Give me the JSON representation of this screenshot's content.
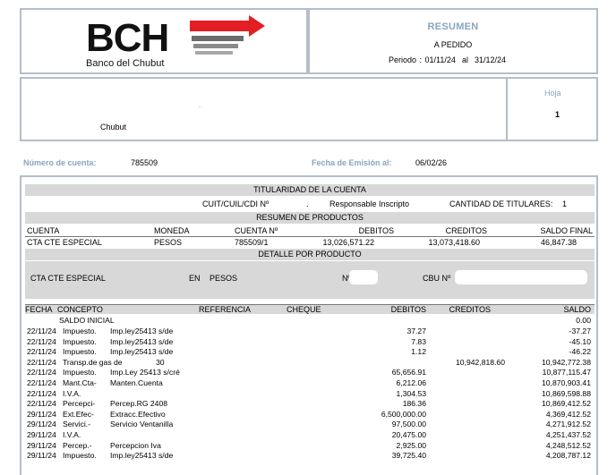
{
  "bank": {
    "logo_text": "BCH",
    "name": "Banco del Chubut",
    "brand_colors": {
      "red": "#e31e24",
      "gray": "#6b6b6b"
    }
  },
  "summary": {
    "title": "RESUMEN",
    "subtitle": "A PEDIDO",
    "period_label": "Periodo :",
    "period_from": "01/11/24",
    "period_sep": "al",
    "period_to": "31/12/24"
  },
  "client": {
    "dot": ".",
    "city": "Chubut",
    "hoja_label": "Hoja",
    "hoja_value": "1"
  },
  "account_meta": {
    "number_label": "Número de cuenta:",
    "number_value": "785509",
    "issue_label": "Fecha de Emisión al:",
    "issue_value": "06/02/26"
  },
  "titularidad": {
    "title": "TITULARIDAD DE LA CUENTA",
    "cuit_label": "CUIT/CUIL/CDI Nº",
    "dot": ".",
    "condition": "Responsable Inscripto",
    "titulares_label": "CANTIDAD DE TITULARES:",
    "titulares_value": "1"
  },
  "products": {
    "title": "RESUMEN DE PRODUCTOS",
    "headers": [
      "CUENTA",
      "MONEDA",
      "CUENTA Nº",
      "DEBITOS",
      "CREDITOS",
      "SALDO FINAL"
    ],
    "row": [
      "CTA CTE ESPECIAL",
      "PESOS",
      "785509/1",
      "13,026,571.22",
      "13,073,418.60",
      "46,847.38"
    ]
  },
  "detail": {
    "title": "DETALLE POR PRODUCTO",
    "account_type": "CTA CTE ESPECIAL",
    "currency_prefix": "EN",
    "currency": "PESOS",
    "number_label": "Nº",
    "cbu_label": "CBU Nº"
  },
  "movements": {
    "headers": [
      "FECHA",
      "CONCEPTO",
      "REFERENCIA",
      "CHEQUE",
      "DEBITOS",
      "CREDITOS",
      "SALDO"
    ],
    "opening_label": "SALDO INICIAL",
    "opening_balance": "0.00",
    "rows": [
      {
        "fecha": "22/11/24",
        "concepto": "Impuesto.",
        "detalle": "Imp.ley25413 s/de",
        "debito": "37.27",
        "credito": "",
        "saldo": "-37.27"
      },
      {
        "fecha": "22/11/24",
        "concepto": "Impuesto.",
        "detalle": "Imp.ley25413 s/de",
        "debito": "7.83",
        "credito": "",
        "saldo": "-45.10"
      },
      {
        "fecha": "22/11/24",
        "concepto": "Impuesto.",
        "detalle": "Imp.ley25413 s/de",
        "debito": "1.12",
        "credito": "",
        "saldo": "-46.22"
      },
      {
        "fecha": "22/11/24",
        "concepto": "Transp.de gas de",
        "detalle": "30",
        "debito": "",
        "credito": "10,942,818.60",
        "saldo": "10,942,772.38"
      },
      {
        "fecha": "22/11/24",
        "concepto": "Impuesto.",
        "detalle": "Imp.Ley 25413 s/cré",
        "debito": "65,656.91",
        "credito": "",
        "saldo": "10,877,115.47"
      },
      {
        "fecha": "22/11/24",
        "concepto": "Mant.Cta-",
        "detalle": "Manten.Cuenta",
        "debito": "6,212.06",
        "credito": "",
        "saldo": "10,870,903.41"
      },
      {
        "fecha": "22/11/24",
        "concepto": "I.V.A.",
        "detalle": "",
        "debito": "1,304.53",
        "credito": "",
        "saldo": "10,869,598.88"
      },
      {
        "fecha": "22/11/24",
        "concepto": "Percepci-",
        "detalle": "Percep.RG 2408",
        "debito": "186.36",
        "credito": "",
        "saldo": "10,869,412.52"
      },
      {
        "fecha": "29/11/24",
        "concepto": "Ext.Efec-",
        "detalle": "Extracc.Efectivo",
        "debito": "6,500,000.00",
        "credito": "",
        "saldo": "4,369,412.52"
      },
      {
        "fecha": "29/11/24",
        "concepto": "Servici.-",
        "detalle": "Servicio Ventanilla",
        "debito": "97,500.00",
        "credito": "",
        "saldo": "4,271,912.52"
      },
      {
        "fecha": "29/11/24",
        "concepto": "I.V.A.",
        "detalle": "",
        "debito": "20,475.00",
        "credito": "",
        "saldo": "4,251,437.52"
      },
      {
        "fecha": "29/11/24",
        "concepto": "Percep.-",
        "detalle": "Percepcion Iva",
        "debito": "2,925.00",
        "credito": "",
        "saldo": "4,248,512.52"
      },
      {
        "fecha": "29/11/24",
        "concepto": "Impuesto.",
        "detalle": "Imp.ley25413 s/de",
        "debito": "39,725.40",
        "credito": "",
        "saldo": "4,208,787.12"
      }
    ]
  }
}
